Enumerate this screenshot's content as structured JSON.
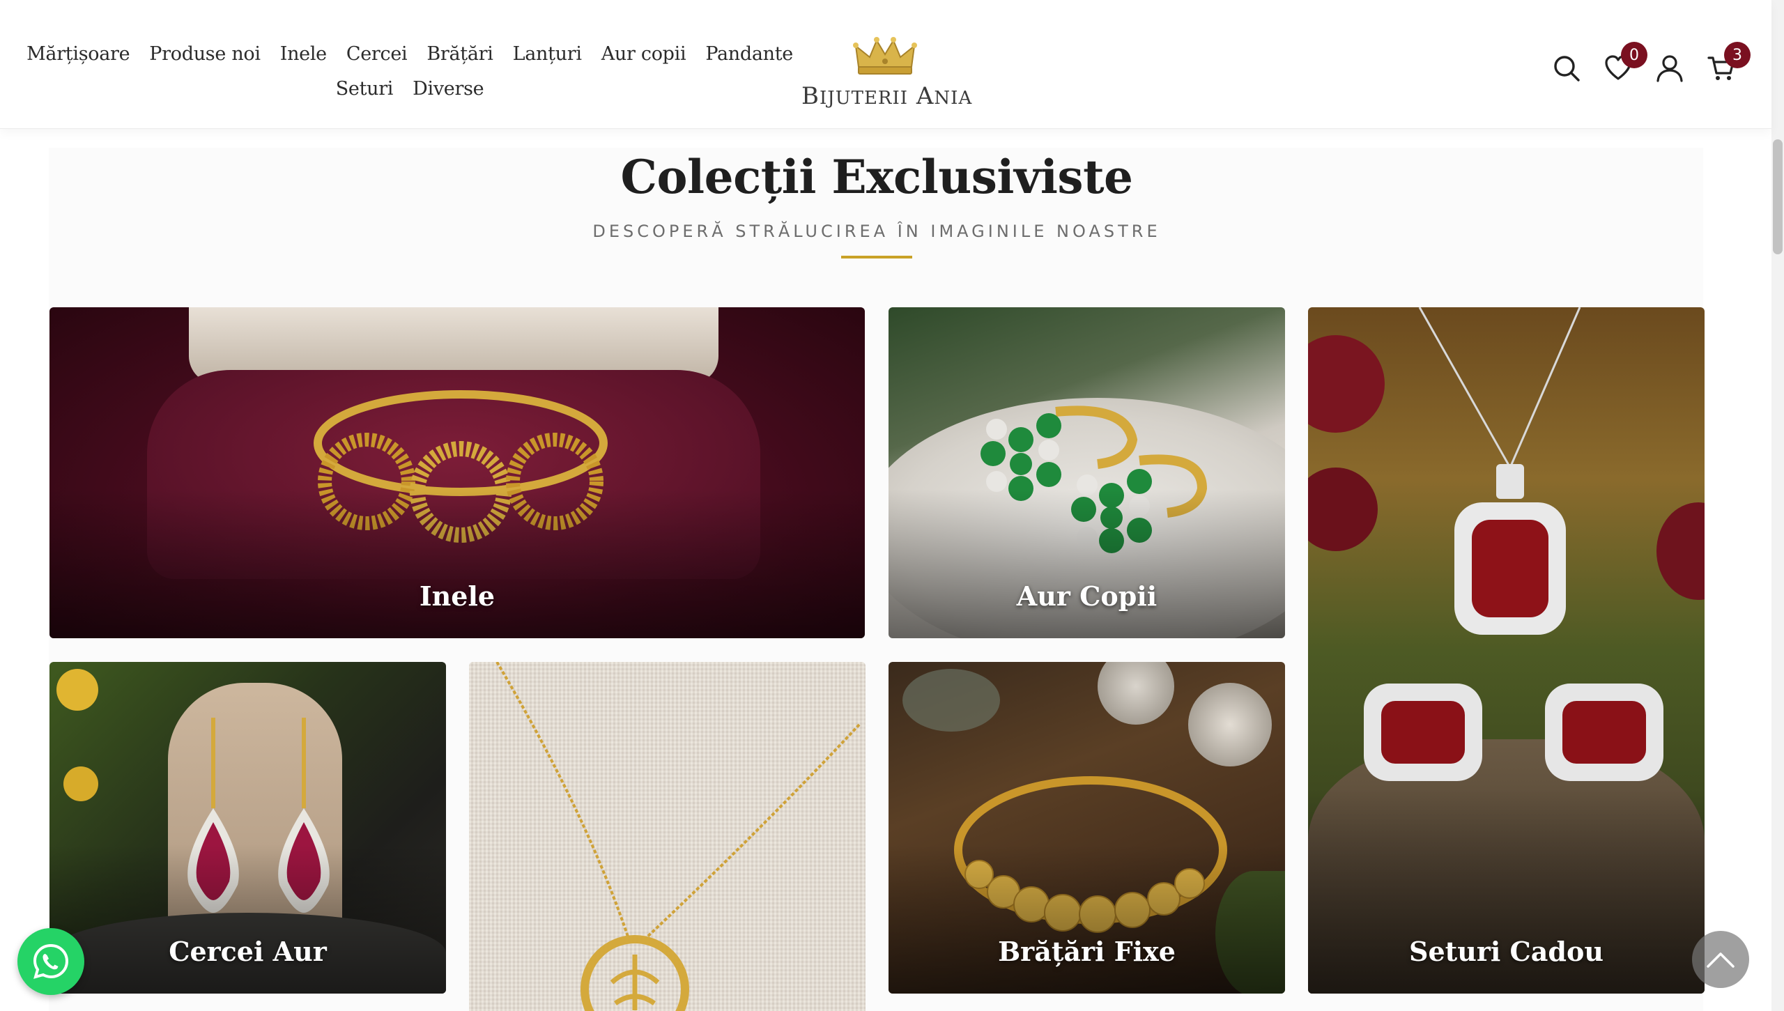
{
  "nav": {
    "row1": [
      "Mărțișoare",
      "Produse noi",
      "Inele",
      "Cercei",
      "Brățări",
      "Lanțuri",
      "Aur copii",
      "Pandante"
    ],
    "row2": [
      "Seturi",
      "Diverse"
    ]
  },
  "logo": {
    "text_first_big": "B",
    "text_first_small": "IJUTERII",
    "text_second_big": "A",
    "text_second_small": "NIA"
  },
  "header_icons": {
    "search": "search-icon",
    "wishlist": {
      "icon": "heart-icon",
      "count": "0"
    },
    "account": "user-icon",
    "cart": {
      "icon": "cart-icon",
      "count": "3"
    }
  },
  "section": {
    "title": "Colecții Exclusiviste",
    "subtitle": "DESCOPERĂ STRĂLUCIREA ÎN IMAGINILE NOASTRE"
  },
  "collections": [
    {
      "label": "Inele"
    },
    {
      "label": "Aur Copii"
    },
    {
      "label": "Seturi Cadou"
    },
    {
      "label": "Cercei Aur"
    },
    {
      "label": ""
    },
    {
      "label": "Brățări Fixe"
    }
  ],
  "colors": {
    "accent_gold": "#c9a227",
    "badge": "#7a1020",
    "whatsapp": "#25d366"
  }
}
